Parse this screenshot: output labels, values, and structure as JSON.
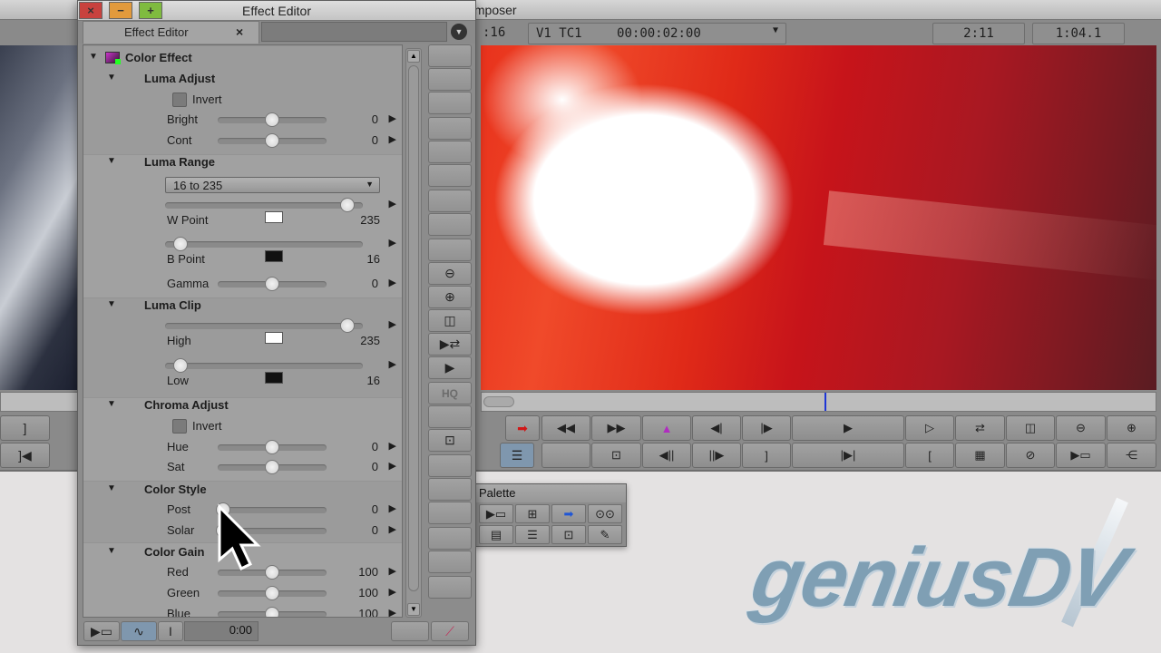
{
  "composer": {
    "title": "Composer",
    "timecode_left": ":16",
    "track": "V1",
    "tc_mode": "TC1",
    "timecode": "00:00:02:00",
    "readout_1": "2:11",
    "readout_2": "1:04.1",
    "row1_buttons": [
      "rewind-icon",
      "fast-forward-icon",
      "mark-clip-icon",
      "step-back-icon",
      "step-forward-icon",
      "play-icon",
      "play-loop-icon",
      "play-loop-arrows-icon",
      "split-view-icon",
      "zoom-out-icon",
      "zoom-in-icon"
    ],
    "row2_buttons": [
      "blank",
      "set-mark-icon",
      "step-back-10-icon",
      "step-forward-10-icon",
      "mark-out-icon",
      "go-to-out-icon",
      "mark-in-icon",
      "dissolve-icon",
      "clear-icon",
      "add-edit-icon",
      "effect-icon"
    ],
    "row1_glyphs": [
      "◀◀",
      "▶▶",
      "▲",
      "◀|",
      "|▶",
      "▶",
      "▷",
      "⇄",
      "◫",
      "⊖",
      "⊕"
    ],
    "row2_glyphs": [
      "",
      "⊡",
      "◀||",
      "||▶",
      "]",
      "|▶|",
      "[",
      "▦",
      "⊘",
      "▶▭",
      "⋲"
    ]
  },
  "effect_editor": {
    "window_title": "Effect Editor",
    "tab_label": "Effect Editor",
    "tab_close": "×",
    "timecode": "0:00",
    "sections": {
      "color_effect": "Color Effect",
      "luma_adjust": "Luma Adjust",
      "luma_range": "Luma Range",
      "luma_clip": "Luma Clip",
      "chroma_adjust": "Chroma Adjust",
      "color_style": "Color Style",
      "color_gain": "Color Gain"
    },
    "params": {
      "luma_invert": {
        "label": "Invert",
        "checked": false
      },
      "bright": {
        "label": "Bright",
        "value": "0",
        "fraction": 0.5
      },
      "cont": {
        "label": "Cont",
        "value": "0",
        "fraction": 0.5
      },
      "range_select": "16 to 235",
      "w_point": {
        "label": "W Point",
        "value": "235",
        "fraction": 0.92,
        "swatch": "#ffffff"
      },
      "b_point": {
        "label": "B Point",
        "value": "16",
        "fraction": 0.08,
        "swatch": "#111111"
      },
      "gamma": {
        "label": "Gamma",
        "value": "0",
        "fraction": 0.5
      },
      "high": {
        "label": "High",
        "value": "235",
        "fraction": 0.92,
        "swatch": "#ffffff"
      },
      "low": {
        "label": "Low",
        "value": "16",
        "fraction": 0.08,
        "swatch": "#111111"
      },
      "chroma_invert": {
        "label": "Invert",
        "checked": false
      },
      "hue": {
        "label": "Hue",
        "value": "0",
        "fraction": 0.5
      },
      "sat": {
        "label": "Sat",
        "value": "0",
        "fraction": 0.5
      },
      "post": {
        "label": "Post",
        "value": "0",
        "fraction": 0.05
      },
      "solar": {
        "label": "Solar",
        "value": "0",
        "fraction": 0.05
      },
      "red": {
        "label": "Red",
        "value": "100",
        "fraction": 0.5
      },
      "green": {
        "label": "Green",
        "value": "100",
        "fraction": 0.5
      },
      "blue": {
        "label": "Blue",
        "value": "100",
        "fraction": 0.5
      }
    },
    "tools": {
      "hq_label": "HQ"
    }
  },
  "palette": {
    "title": "Palette"
  },
  "logo": "geniusDV"
}
